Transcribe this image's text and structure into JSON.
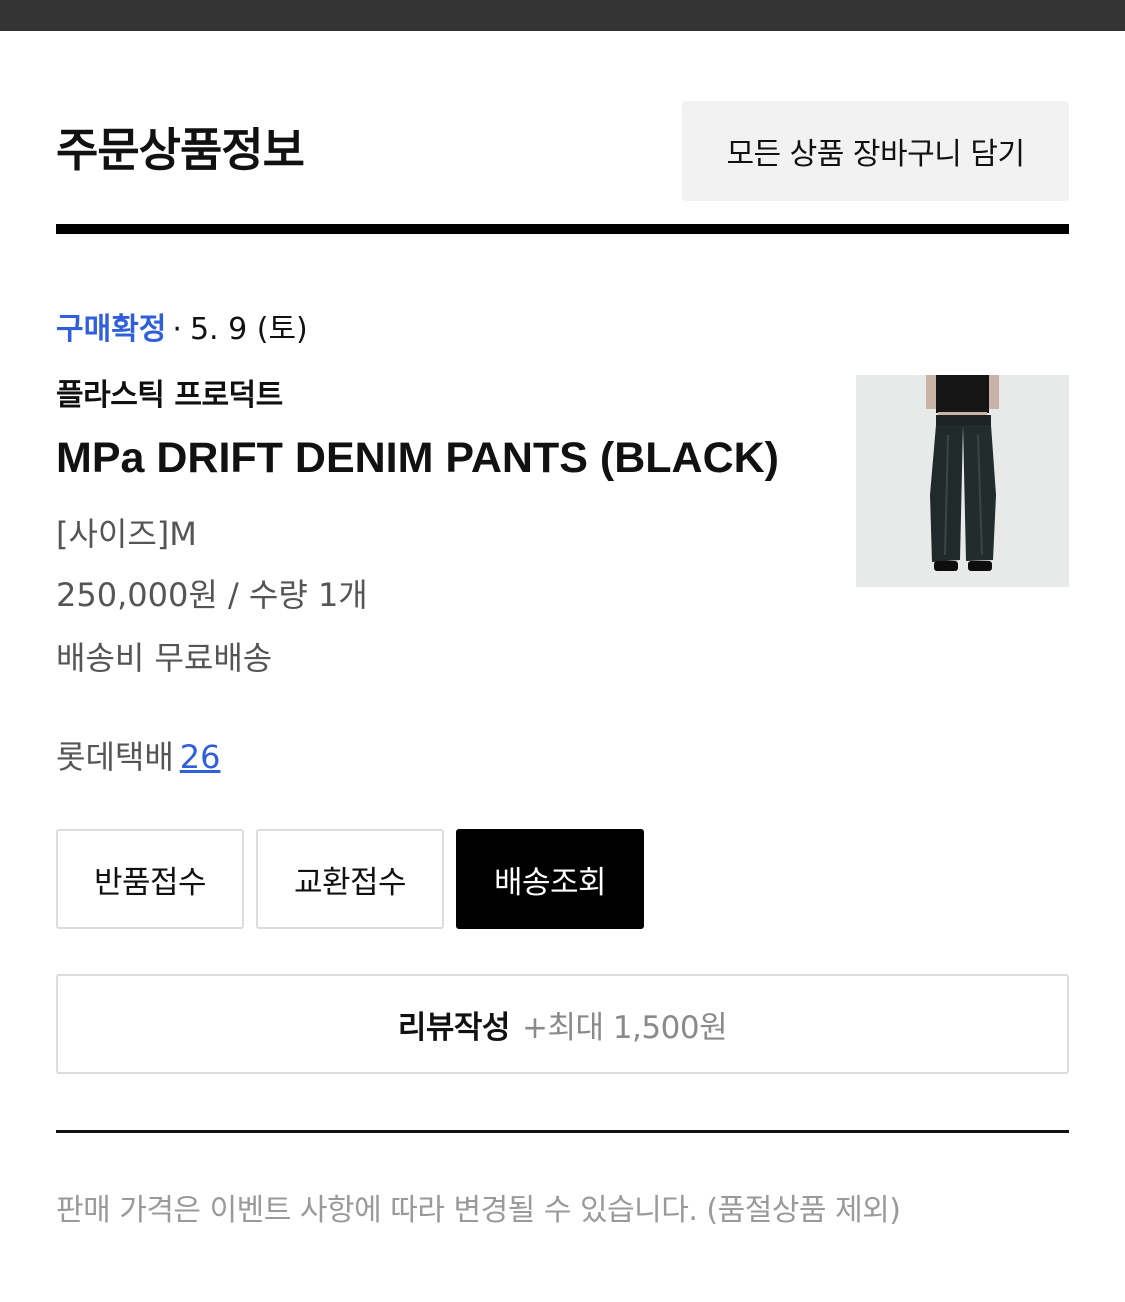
{
  "header": {
    "title": "주문상품정보",
    "add_all_to_cart_label": "모든 상품 장바구니 담기"
  },
  "order_item": {
    "status": "구매확정",
    "separator": "·",
    "date": "5. 9 (토)",
    "brand": "플라스틱 프로덕트",
    "product_name": "MPa DRIFT DENIM PANTS (BLACK)",
    "option": "[사이즈]M",
    "price_quantity": "250,000원 / 수량 1개",
    "shipping_fee": "배송비 무료배송",
    "courier": "롯데택배",
    "tracking_number": "26",
    "image_icon": "product-photo"
  },
  "actions": {
    "return_label": "반품접수",
    "exchange_label": "교환접수",
    "track_label": "배송조회"
  },
  "review": {
    "label": "리뷰작성",
    "reward": "+최대 1,500원"
  },
  "notice": "판매 가격은 이벤트 사항에 따라 변경될 수 있습니다. (품절상품 제외)",
  "colors": {
    "status_blue": "#2f5fdb",
    "top_bar": "#333333",
    "primary_button": "#000000"
  }
}
